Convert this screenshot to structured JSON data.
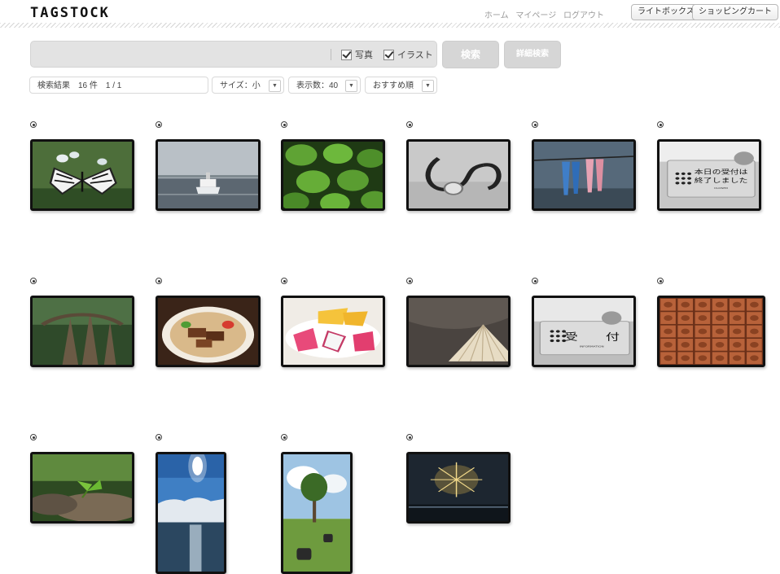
{
  "header": {
    "logo": "TAGSTOCK",
    "nav": [
      "ホーム",
      "マイページ",
      "ログアウト"
    ],
    "lightbox_label": "ライトボックス",
    "cart_label": "ショッピングカート"
  },
  "search": {
    "query": "",
    "photo_label": "写真",
    "photo_checked": true,
    "illust_label": "イラスト",
    "illust_checked": true,
    "search_button": "検索",
    "advanced_button": "詳細検索"
  },
  "results": {
    "summary": "検索結果　16 件　1 / 1",
    "size_select": "サイズ：小",
    "count_select": "表示数：40",
    "sort_select": "おすすめ順"
  },
  "images": [
    {
      "id": "butterfly",
      "icon": "butterfly-photo"
    },
    {
      "id": "ship",
      "icon": "ferry-ship-photo"
    },
    {
      "id": "leaves",
      "icon": "green-leaves-photo"
    },
    {
      "id": "stethoscope",
      "icon": "stethoscope-photo"
    },
    {
      "id": "clothespins",
      "icon": "clothespins-photo"
    },
    {
      "id": "closed-sign",
      "icon": "reception-closed-sign-photo",
      "text": [
        "本日の受付は",
        "終了しました"
      ],
      "small": "CLOSED"
    },
    {
      "id": "banyan",
      "icon": "banyan-tree-photo"
    },
    {
      "id": "soba",
      "icon": "okinawa-soba-photo"
    },
    {
      "id": "fruit",
      "icon": "tropical-fruit-photo"
    },
    {
      "id": "hat",
      "icon": "conical-hat-photo"
    },
    {
      "id": "reception-sign",
      "icon": "reception-sign-photo",
      "text": [
        "受　　付"
      ],
      "small": "INFORMATION"
    },
    {
      "id": "shisa-tiles",
      "icon": "shisa-tiles-photo"
    },
    {
      "id": "sprout",
      "icon": "sprout-on-stump-photo"
    },
    {
      "id": "sea-sun",
      "icon": "sun-over-sea-photo"
    },
    {
      "id": "cows",
      "icon": "cows-under-tree-photo"
    },
    {
      "id": "fireworks",
      "icon": "fireworks-photo"
    }
  ]
}
